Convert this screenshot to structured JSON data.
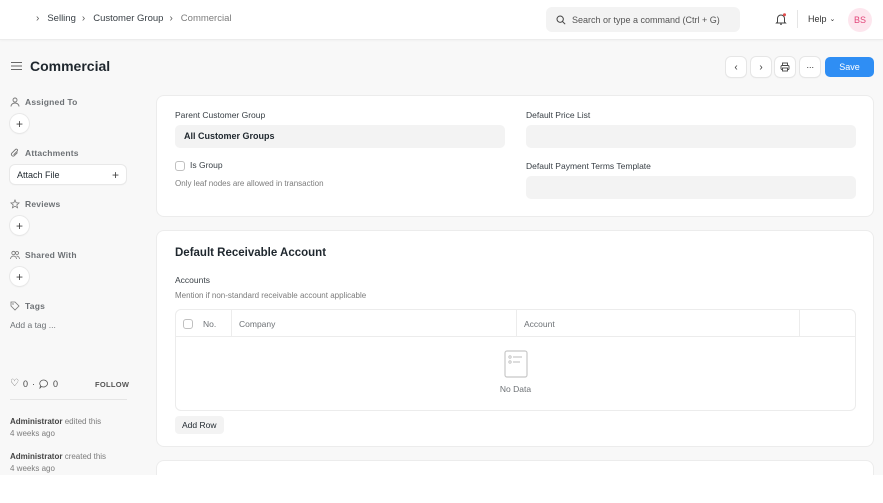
{
  "navbar": {
    "breadcrumbs": [
      "Selling",
      "Customer Group",
      "Commercial"
    ],
    "search_placeholder": "Search or type a command (Ctrl + G)",
    "help_label": "Help",
    "avatar_initials": "BS",
    "notification_dot_color": "#e24c4c"
  },
  "page": {
    "title": "Commercial",
    "save_label": "Save",
    "accent_color": "#2f8ef4"
  },
  "sidebar": {
    "assigned_to": "Assigned To",
    "attachments": "Attachments",
    "attach_file": "Attach File",
    "reviews": "Reviews",
    "shared_with": "Shared With",
    "tags": "Tags",
    "add_tag": "Add a tag ...",
    "likes_count": "0",
    "comments_count": "0",
    "follow_label": "FOLLOW",
    "activity": [
      {
        "user": "Administrator",
        "action": "edited this",
        "time": "4 weeks ago"
      },
      {
        "user": "Administrator",
        "action": "created this",
        "time": "4 weeks ago"
      }
    ]
  },
  "details": {
    "parent_group_label": "Parent Customer Group",
    "parent_group_value": "All Customer Groups",
    "is_group_label": "Is Group",
    "is_group_checked": false,
    "is_group_desc": "Only leaf nodes are allowed in transaction",
    "price_list_label": "Default Price List",
    "price_list_value": "",
    "payment_terms_label": "Default Payment Terms Template",
    "payment_terms_value": ""
  },
  "receivable": {
    "title": "Default Receivable Account",
    "accounts_label": "Accounts",
    "accounts_desc": "Mention if non-standard receivable account applicable",
    "columns": [
      "No.",
      "Company",
      "Account"
    ],
    "rows": [],
    "empty_text": "No Data",
    "add_row_label": "Add Row"
  }
}
